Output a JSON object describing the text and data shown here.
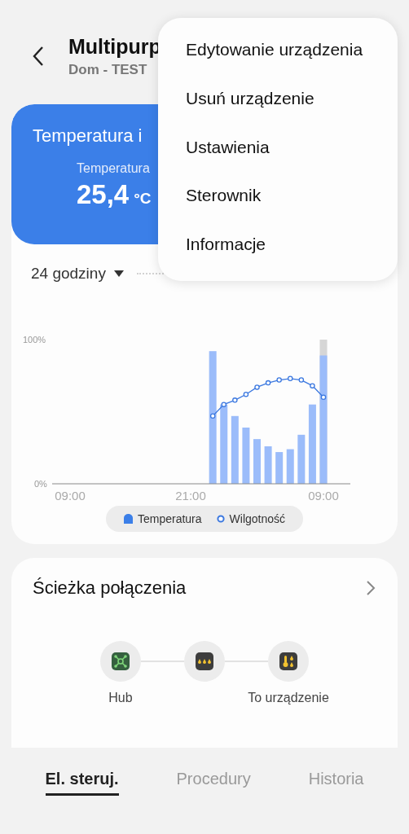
{
  "header": {
    "title": "Multipurp",
    "subtitle": "Dom - TEST"
  },
  "menu": {
    "items": [
      "Edytowanie urządzenia",
      "Usuń urządzenie",
      "Ustawienia",
      "Sterownik",
      "Informacje"
    ]
  },
  "sensor_card": {
    "title": "Temperatura i",
    "reading_label": "Temperatura",
    "value": "25,4",
    "unit": "°C"
  },
  "range_dropdown": {
    "value": "24 godziny"
  },
  "chart_data": {
    "type": "bar",
    "categories": [
      "09:00",
      null,
      null,
      null,
      null,
      null,
      null,
      null,
      null,
      null,
      null,
      null,
      "21:00",
      null,
      null,
      null,
      null,
      null,
      null,
      null,
      null,
      null,
      null,
      null,
      "09:00"
    ],
    "series": [
      {
        "name": "Temperatura",
        "color": "#9bbcfa",
        "values": [
          null,
          null,
          null,
          null,
          null,
          null,
          null,
          null,
          null,
          null,
          null,
          null,
          null,
          null,
          92,
          55,
          47,
          39,
          31,
          26,
          22,
          24,
          34,
          55,
          89
        ]
      },
      {
        "name": "Wilgotność",
        "type": "line",
        "marker": "circle",
        "color": "#3b78e0",
        "values": [
          null,
          null,
          null,
          null,
          null,
          null,
          null,
          null,
          null,
          null,
          null,
          null,
          null,
          null,
          47,
          55,
          58,
          62,
          67,
          70,
          72,
          73,
          72,
          68,
          60
        ]
      }
    ],
    "ylim": [
      0,
      100
    ],
    "yticks": [
      {
        "value": 0,
        "label": "0%"
      },
      {
        "value": 100,
        "label": "100%"
      }
    ]
  },
  "connection": {
    "title": "Ścieżka połączenia",
    "nodes": [
      {
        "kind": "hub",
        "label": "Hub"
      },
      {
        "kind": "drops"
      },
      {
        "kind": "device",
        "label": "To urządzenie"
      }
    ]
  },
  "tabs": [
    {
      "label": "El. steruj.",
      "selected": true
    },
    {
      "label": "Procedury",
      "selected": false
    },
    {
      "label": "Historia",
      "selected": false
    }
  ]
}
